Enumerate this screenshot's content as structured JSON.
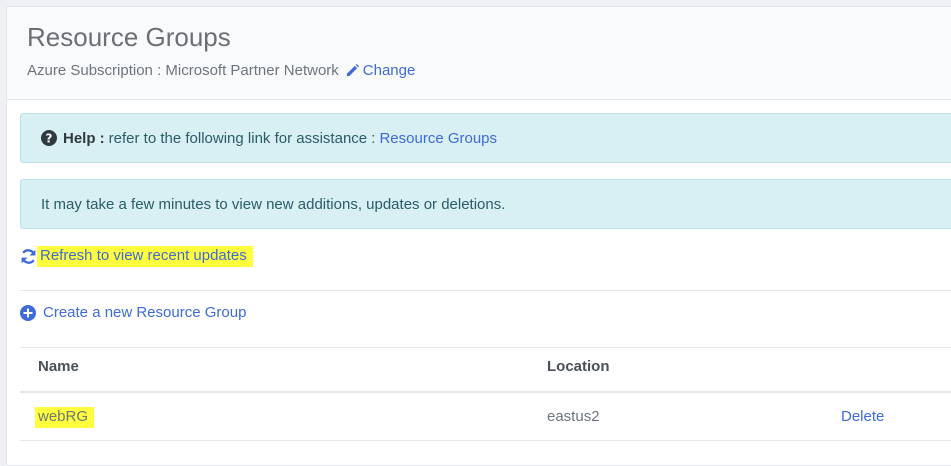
{
  "header": {
    "title": "Resource Groups",
    "subscription_label": "Azure Subscription : Microsoft Partner Network",
    "change_label": "Change"
  },
  "help_alert": {
    "label": "Help :",
    "text": "refer to the following link for assistance :",
    "link": "Resource Groups"
  },
  "info_alert": {
    "text": "It may take a few minutes to view new additions, updates or deletions."
  },
  "refresh": {
    "label": "Refresh to view recent updates"
  },
  "create": {
    "label": "Create a new Resource Group"
  },
  "table": {
    "columns": [
      "Name",
      "Location"
    ],
    "rows": [
      {
        "name": "webRG",
        "location": "eastus2",
        "action": "Delete"
      }
    ]
  },
  "colors": {
    "link": "#3f6ad8",
    "alert_bg": "#d8eff3",
    "highlight": "#ffff3d"
  }
}
